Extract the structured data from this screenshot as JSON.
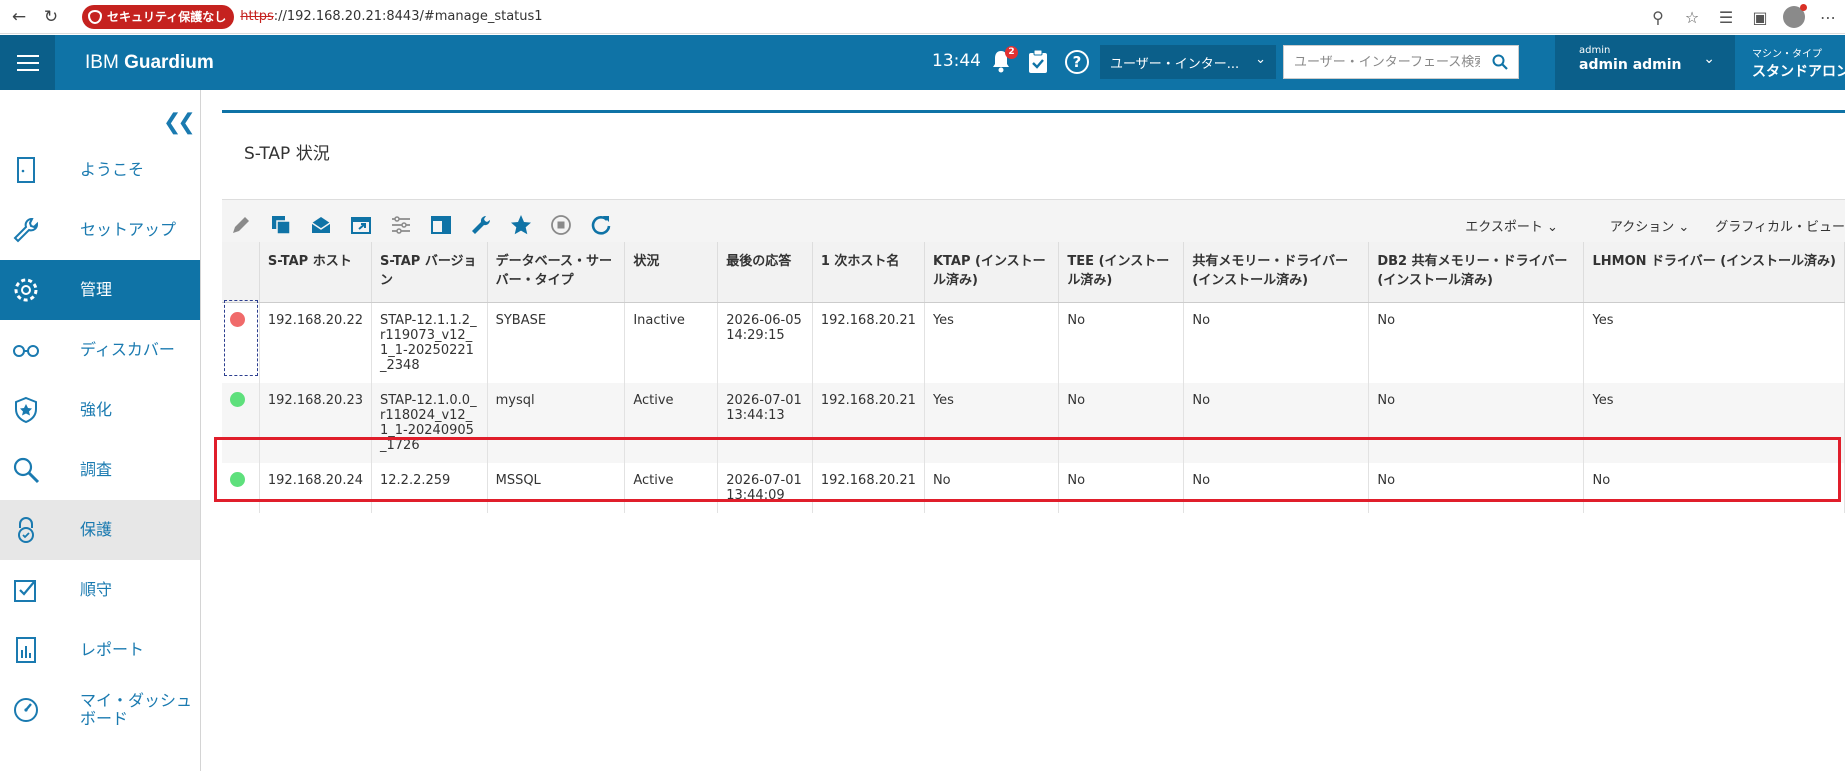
{
  "browser": {
    "security_label": "セキュリティ保護なし",
    "url_scheme": "https",
    "url_rest": "://192.168.20.21:8443/#manage_status1"
  },
  "header": {
    "brand_prefix": "IBM ",
    "brand_name": "Guardium",
    "time": "13:44",
    "notification_count": "2",
    "ui_select_value": "ユーザー・インター...",
    "search_placeholder": "ユーザー・インターフェース検索",
    "user_small": "admin",
    "user_name": "admin admin",
    "machine_small": "マシン・タイプ",
    "machine_type": "スタンドアロン"
  },
  "sidebar": {
    "items": [
      {
        "label": "ようこそ",
        "icon": "door-icon"
      },
      {
        "label": "セットアップ",
        "icon": "wrench-icon"
      },
      {
        "label": "管理",
        "icon": "gear-icon"
      },
      {
        "label": "ディスカバー",
        "icon": "glasses-icon"
      },
      {
        "label": "強化",
        "icon": "shield-star-icon"
      },
      {
        "label": "調査",
        "icon": "magnifier-icon"
      },
      {
        "label": "保護",
        "icon": "lock-icon"
      },
      {
        "label": "順守",
        "icon": "checkbox-icon"
      },
      {
        "label": "レポート",
        "icon": "report-icon"
      },
      {
        "label": "マイ・ダッシュボード",
        "label_line2": "ボード",
        "label_line1": "マイ・ダッシュ",
        "icon": "dashboard-icon"
      }
    ]
  },
  "panel": {
    "title": "S-TAP 状況",
    "export_label": "エクスポート",
    "action_label": "アクション",
    "graphical_label": "グラフィカル・ビュー"
  },
  "table": {
    "headers": [
      "S-TAP ホスト",
      "S-TAP バージョン",
      "データベース・サーバー・タイプ",
      "状況",
      "最後の応答",
      "1 次ホスト名",
      "KTAP (インストール済み)",
      "TEE (インストール済み)",
      "共有メモリー・ドライバー (インストール済み)",
      "DB2 共有メモリー・ドライバー (インストール済み)",
      "LHMON ドライバー (インストール済み)"
    ],
    "rows": [
      {
        "status_color": "#f06a6a",
        "host": "192.168.20.22",
        "version": "STAP-12.1.1.2_r119073_v12_1_1-20250221_2348",
        "db_type": "SYBASE",
        "state": "Inactive",
        "last_response": "2026-06-05 14:29:15",
        "primary_host": "192.168.20.21",
        "ktap": "Yes",
        "tee": "No",
        "shm": "No",
        "db2shm": "No",
        "lhmon": "Yes"
      },
      {
        "status_color": "#5ee07c",
        "host": "192.168.20.23",
        "version": "STAP-12.1.0.0_r118024_v12_1_1-20240905_1726",
        "db_type": "mysql",
        "state": "Active",
        "last_response": "2026-07-01 13:44:13",
        "primary_host": "192.168.20.21",
        "ktap": "Yes",
        "tee": "No",
        "shm": "No",
        "db2shm": "No",
        "lhmon": "Yes"
      },
      {
        "status_color": "#5ee07c",
        "host": "192.168.20.24",
        "version": "12.2.2.259",
        "db_type": "MSSQL",
        "state": "Active",
        "last_response": "2026-07-01 13:44:09",
        "primary_host": "192.168.20.21",
        "ktap": "No",
        "tee": "No",
        "shm": "No",
        "db2shm": "No",
        "lhmon": "No"
      }
    ]
  },
  "colors": {
    "brand_blue": "#0f73a6",
    "brand_blue_dark": "#0b5f8a",
    "highlight_red": "#e01e2b"
  }
}
